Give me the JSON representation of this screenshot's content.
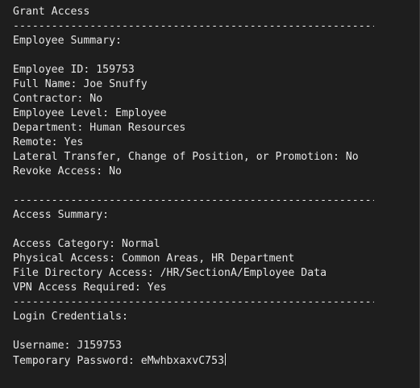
{
  "title": "Grant Access",
  "separator": "----------------------------------------------------------------",
  "employee_summary": {
    "heading": "Employee Summary:",
    "lines": [
      "Employee ID: 159753",
      "Full Name: Joe Snuffy",
      "Contractor: No",
      "Employee Level: Employee",
      "Department: Human Resources",
      "Remote: Yes",
      "Lateral Transfer, Change of Position, or Promotion: No",
      "Revoke Access: No"
    ]
  },
  "access_summary": {
    "heading": "Access Summary:",
    "lines": [
      "Access Category: Normal",
      "Physical Access: Common Areas, HR Department",
      "File Directory Access: /HR/SectionA/Employee Data",
      "VPN Access Required: Yes"
    ]
  },
  "login_credentials": {
    "heading": "Login Credentials:",
    "lines": [
      "Username: J159753",
      "Temporary Password: eMwhbxaxvC753"
    ]
  }
}
